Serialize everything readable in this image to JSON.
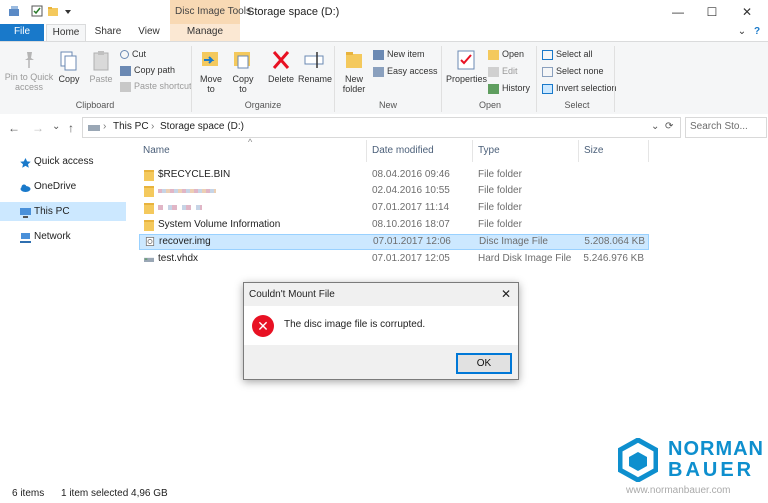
{
  "titlebar": {
    "context_tab": "Disc Image Tools",
    "window_title": "Storage space (D:)",
    "minimize": "—",
    "maximize": "☐",
    "close": "✕"
  },
  "tabs": {
    "file": "File",
    "home": "Home",
    "share": "Share",
    "view": "View",
    "manage": "Manage"
  },
  "ribbon": {
    "clipboard": {
      "pin": [
        "Pin to Quick",
        "access"
      ],
      "copy": "Copy",
      "paste": "Paste",
      "cut": "Cut",
      "copy_path": "Copy path",
      "paste_shortcut": "Paste shortcut",
      "group": "Clipboard"
    },
    "organize": {
      "move_to": [
        "Move",
        "to"
      ],
      "copy_to": [
        "Copy",
        "to"
      ],
      "delete": "Delete",
      "rename": "Rename",
      "group": "Organize"
    },
    "new": {
      "new_folder": [
        "New",
        "folder"
      ],
      "new_item": "New item",
      "easy_access": "Easy access",
      "group": "New"
    },
    "open": {
      "properties": "Properties",
      "open": "Open",
      "edit": "Edit",
      "history": "History",
      "group": "Open"
    },
    "select": {
      "select_all": "Select all",
      "select_none": "Select none",
      "invert_selection": "Invert selection",
      "group": "Select"
    },
    "expand": "⌄",
    "help": "?"
  },
  "address": {
    "back": "←",
    "forward": "→",
    "dropdown": "⌄",
    "up": "↑",
    "crumbs": [
      "This PC",
      "Storage space (D:)"
    ],
    "crumb_sep": "›",
    "search_placeholder": "Search Sto...",
    "refresh": "⟳"
  },
  "nav_pane": [
    {
      "label": "Quick access",
      "icon": "star-icon",
      "selected": false
    },
    {
      "label": "OneDrive",
      "icon": "cloud-icon",
      "selected": false
    },
    {
      "label": "This PC",
      "icon": "computer-icon",
      "selected": true
    },
    {
      "label": "Network",
      "icon": "network-icon",
      "selected": false
    }
  ],
  "columns": {
    "name": "Name",
    "date": "Date modified",
    "type": "Type",
    "size": "Size",
    "sort_arrow": "^"
  },
  "files": [
    {
      "name": "$RECYCLE.BIN",
      "date": "08.04.2016 09:46",
      "type": "File folder",
      "size": "",
      "icon": "folder-icon",
      "selected": false
    },
    {
      "name": "",
      "date": "02.04.2016 10:55",
      "type": "File folder",
      "size": "",
      "icon": "folder-icon",
      "selected": false
    },
    {
      "name": "",
      "date": "07.01.2017 11:14",
      "type": "File folder",
      "size": "",
      "icon": "folder-icon",
      "selected": false
    },
    {
      "name": "System Volume Information",
      "date": "08.10.2016 18:07",
      "type": "File folder",
      "size": "",
      "icon": "folder-icon",
      "selected": false
    },
    {
      "name": "recover.img",
      "date": "07.01.2017 12:06",
      "type": "Disc Image File",
      "size": "5.208.064 KB",
      "icon": "disc-image-icon",
      "selected": true
    },
    {
      "name": "test.vhdx",
      "date": "07.01.2017 12:05",
      "type": "Hard Disk Image File",
      "size": "5.246.976 KB",
      "icon": "hard-disk-icon",
      "selected": false
    }
  ],
  "dialog": {
    "title": "Couldn't Mount File",
    "close": "✕",
    "error_glyph": "✕",
    "message": "The disc image file is corrupted.",
    "ok": "OK"
  },
  "status": {
    "items": "6 items",
    "selected": "1 item selected  4,96 GB"
  },
  "watermark": {
    "line1": "NORMAN",
    "line2": "BAUER",
    "url": "www.normanbauer.com"
  },
  "colors": {
    "accent": "#1979ca",
    "selection": "#cce8ff",
    "context_tab": "#f8d9b4",
    "error": "#e81123",
    "watermark": "#0e8fce"
  }
}
